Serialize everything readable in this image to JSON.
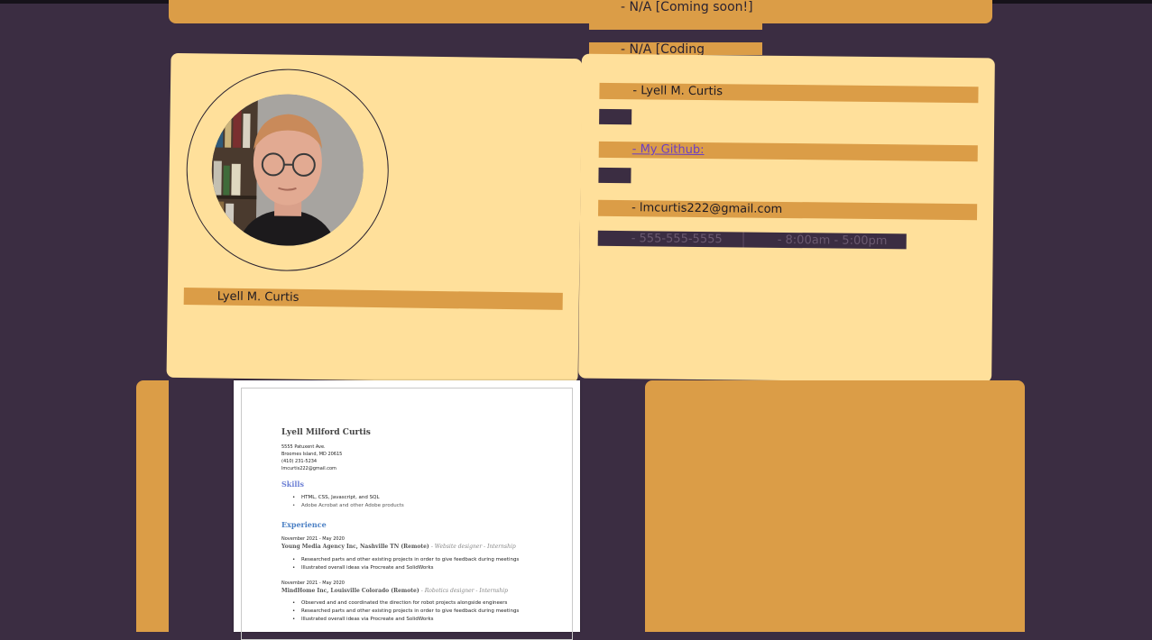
{
  "top": {
    "coming_soon_text": "- N/A [Coming soon!]",
    "coding_text": "- N/A [Coding"
  },
  "profile": {
    "name": "Lyell M. Curtis"
  },
  "contact": {
    "name": "- Lyell M. Curtis",
    "github_label": "- My Github:",
    "email": "- lmcurtis222@gmail.com",
    "phone": "- 555-555-5555",
    "hours": "- 8:00am - 5:00pm"
  },
  "resume": {
    "name": "Lyell Milford Curtis",
    "address1": "5555 Patuxent Ave.",
    "address2": "Broomes Island, MD 20615",
    "phone": "(410) 231-5234",
    "email": "lmcurtis222@gmail.com",
    "skills_heading": "Skills",
    "skills": [
      "HTML, CSS, Javascript, and SQL",
      "Adobe Acrobat and other Adobe products"
    ],
    "experience_heading": "Experience",
    "jobs": [
      {
        "dates": "November 2021 - May 2020",
        "company": "Young Media Agency Inc, Nashville TN (Remote)",
        "role": "- Website designer - Internship",
        "bullets": [
          "Researched parts and other existing projects in order to give feedback during meetings",
          "Illustrated overall ideas via Procreate and SolidWorks"
        ]
      },
      {
        "dates": "November 2021 - May 2020",
        "company": "MindHome Inc, Louisville Colorado (Remote)",
        "role": "- Robotics designer - Internship",
        "bullets": [
          "Observed and and coordinated the direction for robot projects alongside engineers",
          "Researched parts and other existing projects in order to give feedback during meetings",
          "Illustrated overall ideas via Procreate and SolidWorks"
        ]
      }
    ]
  },
  "colors": {
    "background": "#3b2d42",
    "orange": "#db9d47",
    "cream": "#ffe09b"
  }
}
